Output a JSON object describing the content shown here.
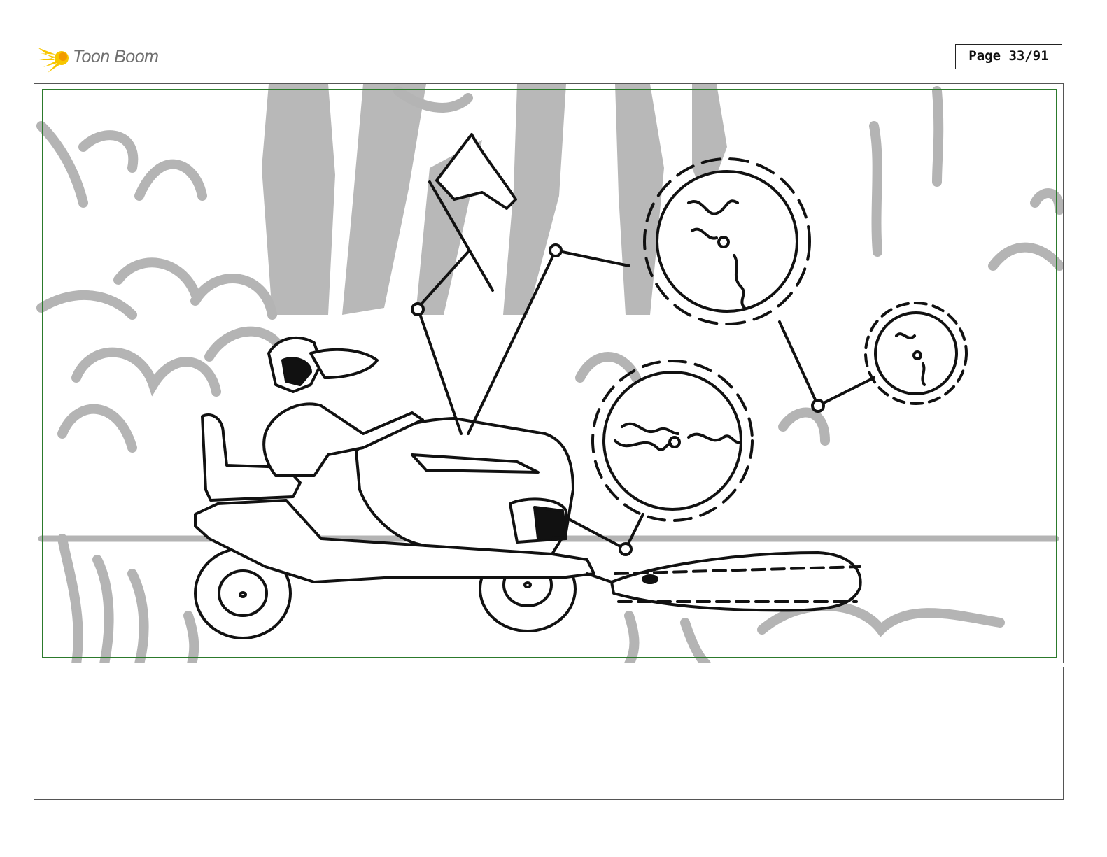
{
  "header": {
    "brand": "Toon Boom",
    "page_label": "Page 33/91"
  },
  "panel": {
    "subject": "storyboard-sketch-riding-mower-with-saw-blades"
  },
  "notes": {
    "text": ""
  },
  "colors": {
    "logo_yellow": "#f7c600",
    "logo_orange": "#f29a00",
    "sketch_gray": "#b4b4b4",
    "ink": "#111111",
    "safe_frame": "#2c7a2c"
  }
}
